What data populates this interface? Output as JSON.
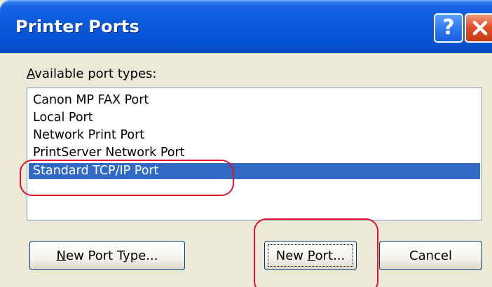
{
  "window": {
    "title": "Printer Ports",
    "help_glyph": "?",
    "title_buttons": [
      "help-icon",
      "close-icon"
    ]
  },
  "label": {
    "prefix_underlined": "A",
    "rest": "vailable port types:"
  },
  "port_types": [
    "Canon MP FAX Port",
    "Local Port",
    "Network Print Port",
    "PrintServer Network Port",
    "Standard TCP/IP Port"
  ],
  "selected_index": 4,
  "buttons": {
    "new_port_type": {
      "mnemonic": "N",
      "rest": "ew Port Type..."
    },
    "new_port": {
      "prefix": "New ",
      "mnemonic": "P",
      "rest": "ort..."
    },
    "cancel": "Cancel"
  },
  "colors": {
    "title_bar": "#0a58d8",
    "selection": "#316ac5",
    "annotation": "#e3122c",
    "dialog_bg": "#ece9d8"
  }
}
